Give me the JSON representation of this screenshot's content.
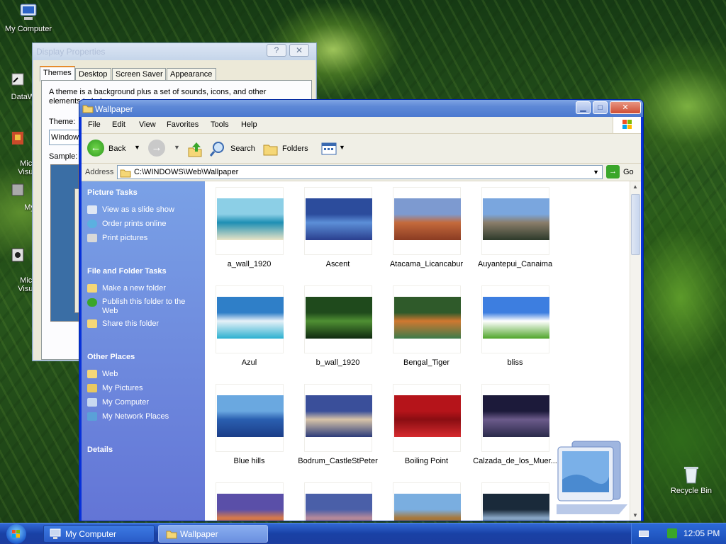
{
  "desktop": {
    "icons": [
      {
        "label": "My Computer"
      },
      {
        "label": "DataWa"
      },
      {
        "label": "Micro\nVisual"
      },
      {
        "label": "Myp"
      },
      {
        "label": "Micro\nVisual"
      },
      {
        "label": "Recycle Bin"
      }
    ]
  },
  "display_properties": {
    "title": "Display Properties",
    "help_label": "?",
    "close_label": "✕",
    "tabs": [
      "Themes",
      "Desktop",
      "Screen Saver",
      "Appearance"
    ],
    "description": "A theme is a background plus a set of sounds, icons, and other elements to help y",
    "theme_label": "Theme:",
    "theme_value": "Window",
    "sample_label": "Sample:"
  },
  "explorer": {
    "title": "Wallpaper",
    "minimize": "▁",
    "maximize": "□",
    "close": "✕",
    "menu": [
      "File",
      "Edit",
      "View",
      "Favorites",
      "Tools",
      "Help"
    ],
    "toolbar": {
      "back": "Back",
      "search": "Search",
      "folders": "Folders"
    },
    "address": {
      "label": "Address",
      "path": "C:\\WINDOWS\\Web\\Wallpaper",
      "go": "Go"
    },
    "tasks": {
      "picture": {
        "title": "Picture Tasks",
        "items": [
          "View as a slide show",
          "Order prints online",
          "Print pictures"
        ]
      },
      "file": {
        "title": "File and Folder Tasks",
        "items": [
          "Make a new folder",
          "Publish this folder to the Web",
          "Share this folder"
        ]
      },
      "other": {
        "title": "Other Places",
        "items": [
          "Web",
          "My Pictures",
          "My Computer",
          "My Network Places"
        ]
      },
      "details": {
        "title": "Details"
      }
    },
    "files": [
      {
        "name": "a_wall_1920",
        "colors": [
          "#8ccfe6",
          "#1d8fb4",
          "#e9e4c6"
        ]
      },
      {
        "name": "Ascent",
        "colors": [
          "#2c4c9c",
          "#5c8fd8",
          "#2a3f8e"
        ]
      },
      {
        "name": "Atacama_Licancabur",
        "colors": [
          "#7d9ad0",
          "#c46a3c",
          "#8a3b22"
        ]
      },
      {
        "name": "Auyantepui_Canaima",
        "colors": [
          "#7aa6de",
          "#8a7d6a",
          "#2d3a2a"
        ]
      },
      {
        "name": "Azul",
        "colors": [
          "#2f7fc8",
          "#e6f1f8",
          "#2bb0d0"
        ]
      },
      {
        "name": "b_wall_1920",
        "colors": [
          "#1f4a1c",
          "#4f8f33",
          "#0f2a10"
        ]
      },
      {
        "name": "Bengal_Tiger",
        "colors": [
          "#2f5a2a",
          "#d07830",
          "#3c7a4a"
        ]
      },
      {
        "name": "bliss",
        "colors": [
          "#3d7ee0",
          "#ffffff",
          "#4fa52a"
        ]
      },
      {
        "name": "Blue hills",
        "colors": [
          "#6aa8e0",
          "#2a5fb0",
          "#1b3d88"
        ]
      },
      {
        "name": "Bodrum_CastleStPeter",
        "colors": [
          "#3a4f9a",
          "#d8c4a8",
          "#2b3b7a"
        ]
      },
      {
        "name": "Boiling Point",
        "colors": [
          "#b5141a",
          "#8a0d12",
          "#d62a2e"
        ]
      },
      {
        "name": "Calzada_de_los_Muer...",
        "colors": [
          "#1c1a3a",
          "#6b5a8a",
          "#2a2a4a"
        ]
      },
      {
        "name": "",
        "colors": [
          "#5a4fa8",
          "#d87a4a",
          "#3a2a6a"
        ]
      },
      {
        "name": "",
        "colors": [
          "#4a5fa8",
          "#b88a9a",
          "#2a3a7a"
        ]
      },
      {
        "name": "",
        "colors": [
          "#7aaee0",
          "#a8783a",
          "#5a5a5a"
        ]
      },
      {
        "name": "",
        "colors": [
          "#1a2a3a",
          "#8aa8c8",
          "#0a1a2a"
        ]
      }
    ]
  },
  "taskbar": {
    "start": "",
    "items": [
      "My Computer",
      "Wallpaper"
    ],
    "clock": "12:05 PM"
  }
}
